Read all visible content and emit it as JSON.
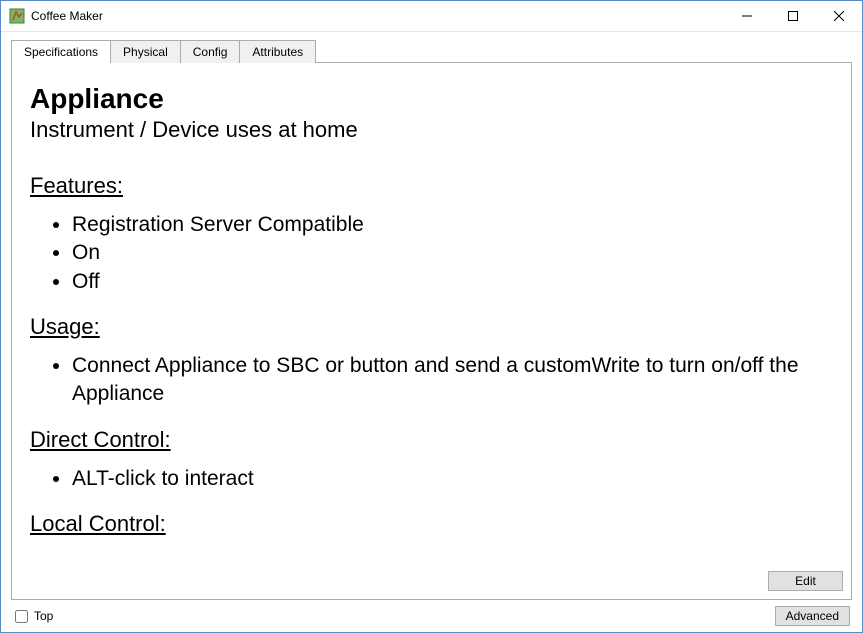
{
  "window": {
    "title": "Coffee Maker"
  },
  "tabs": [
    {
      "label": "Specifications",
      "active": true
    },
    {
      "label": "Physical",
      "active": false
    },
    {
      "label": "Config",
      "active": false
    },
    {
      "label": "Attributes",
      "active": false
    }
  ],
  "doc": {
    "heading": "Appliance",
    "subtitle": "Instrument / Device uses at home",
    "features_heading": "Features:",
    "features": [
      "Registration Server Compatible",
      "On",
      "Off"
    ],
    "usage_heading": "Usage:",
    "usage": [
      "Connect Appliance to SBC or button and send a customWrite to turn on/off the Appliance"
    ],
    "direct_heading": "Direct Control:",
    "direct": [
      "ALT-click to interact"
    ],
    "local_heading": "Local Control:"
  },
  "buttons": {
    "edit": "Edit",
    "advanced": "Advanced"
  },
  "footer": {
    "top_label": "Top"
  }
}
